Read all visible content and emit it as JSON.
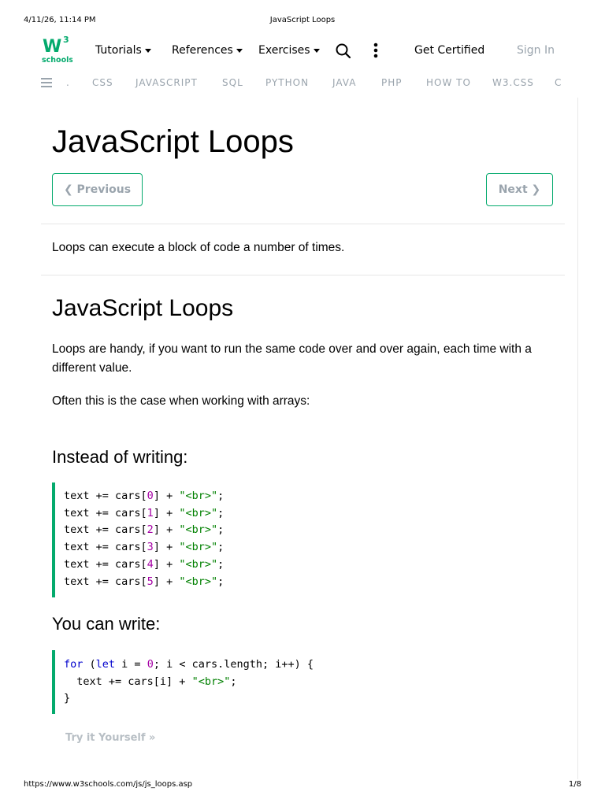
{
  "print_header": {
    "date": "4/11/26, 11:14 PM",
    "title": "JavaScript Loops"
  },
  "logo": {
    "mark": "W",
    "superscript": "3",
    "word": "schools",
    "color": "#04aa6d"
  },
  "topnav": {
    "tutorials": "Tutorials",
    "references": "References",
    "exercises": "Exercises",
    "get_certified": "Get Certified",
    "sign_in": "Sign In"
  },
  "subnav": {
    "items": [
      ".",
      "CSS",
      "JAVASCRIPT",
      "SQL",
      "PYTHON",
      "JAVA",
      "PHP",
      "HOW TO",
      "W3.CSS",
      "C"
    ]
  },
  "page": {
    "title": "JavaScript Loops",
    "previous_label": "❮ Previous",
    "next_label": "Next ❯",
    "intro": "Loops can execute a block of code a number of times.",
    "section_title": "JavaScript Loops",
    "para1": "Loops are handy, if you want to run the same code over and over again, each time with a different value.",
    "para2": "Often this is the case when working with arrays:",
    "heading_instead": "Instead of writing:",
    "heading_can": "You can write:",
    "try_label": "Try it Yourself »"
  },
  "code1": {
    "prefix": "text += cars[",
    "suffix": "] + ",
    "string": "\"<br>\"",
    "end": ";",
    "indices": [
      "0",
      "1",
      "2",
      "3",
      "4",
      "5"
    ]
  },
  "code2": {
    "l1_for": "for",
    "l1_open": " (",
    "l1_let": "let",
    "l1_mid": " i = ",
    "l1_zero": "0",
    "l1_rest": "; i < cars.length; i++) {",
    "l2_pre": "  text += cars[i] + ",
    "l2_str": "\"<br>\"",
    "l2_end": ";",
    "l3": "}"
  },
  "print_footer": {
    "url": "https://www.w3schools.com/js/js_loops.asp",
    "page": "1/8"
  },
  "colors": {
    "accent": "#04aa6d",
    "muted": "#9aa4ad",
    "keyword": "#0000cd",
    "number": "#a500a5",
    "string": "#008000"
  }
}
